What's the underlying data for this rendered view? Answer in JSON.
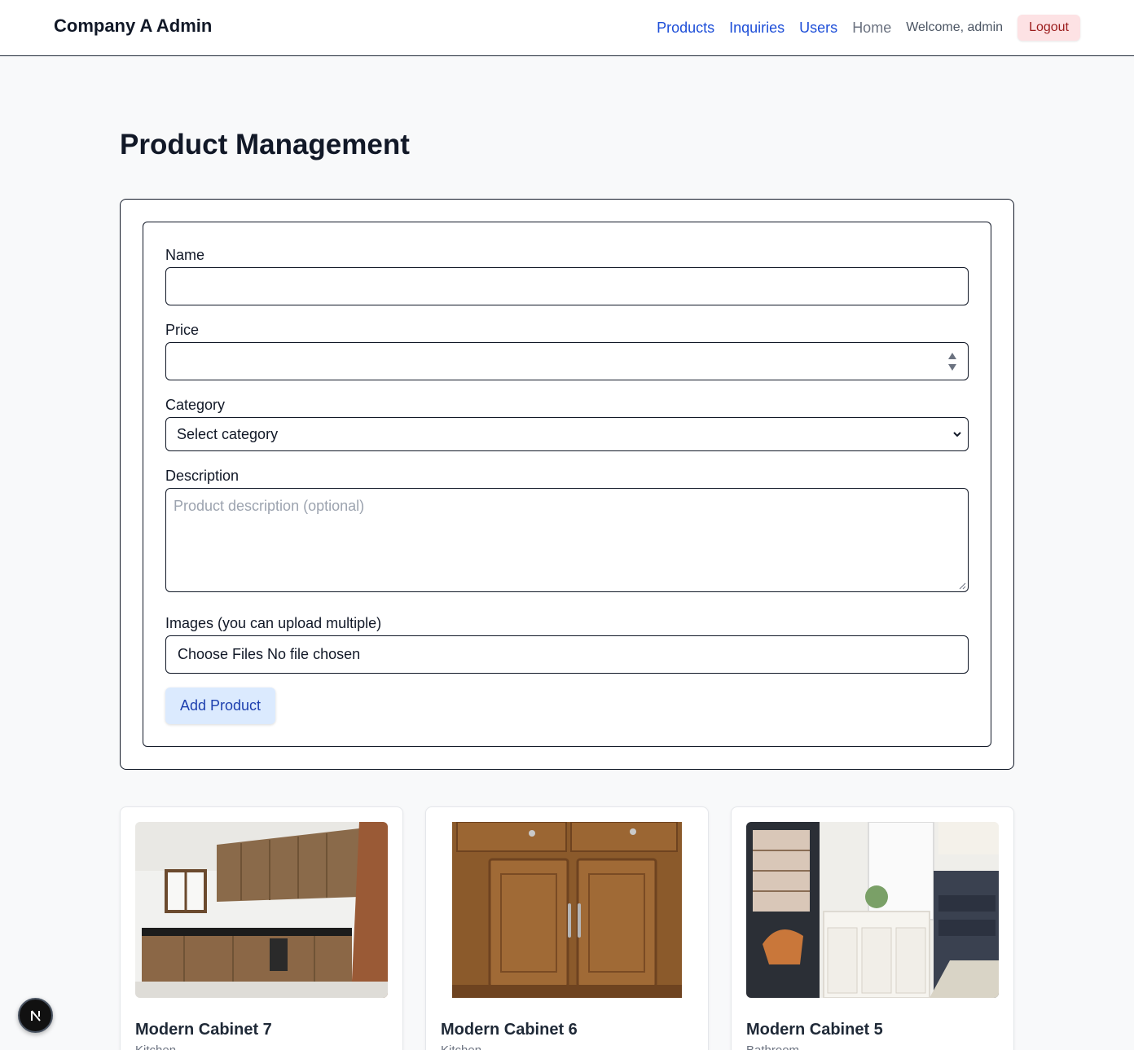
{
  "header": {
    "brand": "Company A Admin",
    "nav": {
      "products": "Products",
      "inquiries": "Inquiries",
      "users": "Users",
      "home": "Home"
    },
    "welcome": "Welcome, admin",
    "logout": "Logout"
  },
  "page": {
    "title": "Product Management"
  },
  "form": {
    "name_label": "Name",
    "name_value": "",
    "price_label": "Price",
    "price_value": "",
    "category_label": "Category",
    "category_selected": "Select category",
    "description_label": "Description",
    "description_placeholder": "Product description (optional)",
    "images_label": "Images (you can upload multiple)",
    "images_button": "Choose Files",
    "images_status": "No file chosen",
    "submit": "Add Product"
  },
  "products": [
    {
      "name": "Modern Cabinet 7",
      "category": "Kitchen"
    },
    {
      "name": "Modern Cabinet 6",
      "category": "Kitchen"
    },
    {
      "name": "Modern Cabinet 5",
      "category": "Bathroom"
    }
  ],
  "dev_badge": {
    "letter": "N"
  },
  "colors": {
    "link": "#1d4ed8",
    "logout_bg": "#fde2e4",
    "logout_text": "#9b1c1c",
    "primary_btn_bg": "#dbeafe",
    "primary_btn_text": "#1e40af",
    "page_bg": "#f8f9fa"
  }
}
